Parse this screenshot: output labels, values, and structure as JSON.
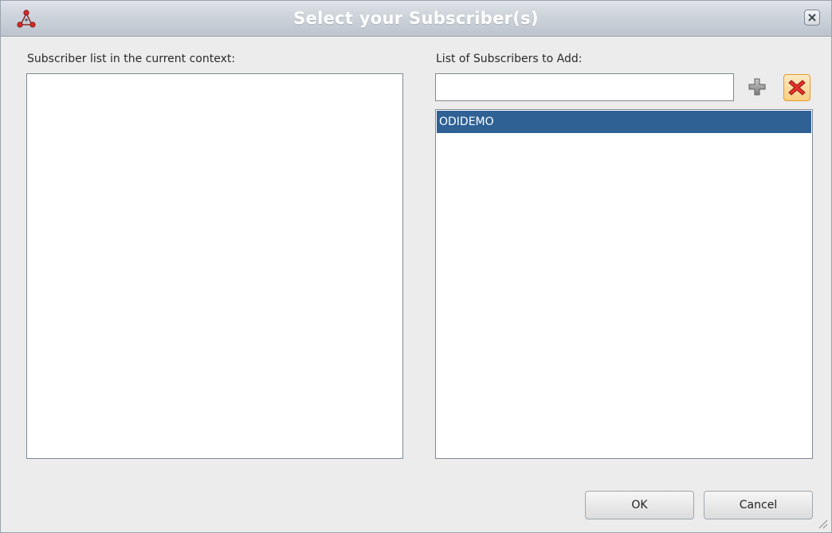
{
  "dialog": {
    "title": "Select your Subscriber(s)",
    "icons": {
      "app": "network-nodes-icon",
      "close": "close-icon",
      "add": "plus-icon",
      "remove": "red-x-icon",
      "resize": "resize-grip-icon"
    },
    "colors": {
      "selection": "#2f6195",
      "remove_accent": "#e39a2f"
    }
  },
  "left_panel": {
    "label": "Subscriber list in the current context:",
    "items": []
  },
  "right_panel": {
    "label": "List of Subscribers to Add:",
    "input_value": "",
    "input_placeholder": "",
    "items": [
      {
        "label": "ODIDEMO",
        "selected": true
      }
    ]
  },
  "buttons": {
    "ok": "OK",
    "cancel": "Cancel"
  }
}
